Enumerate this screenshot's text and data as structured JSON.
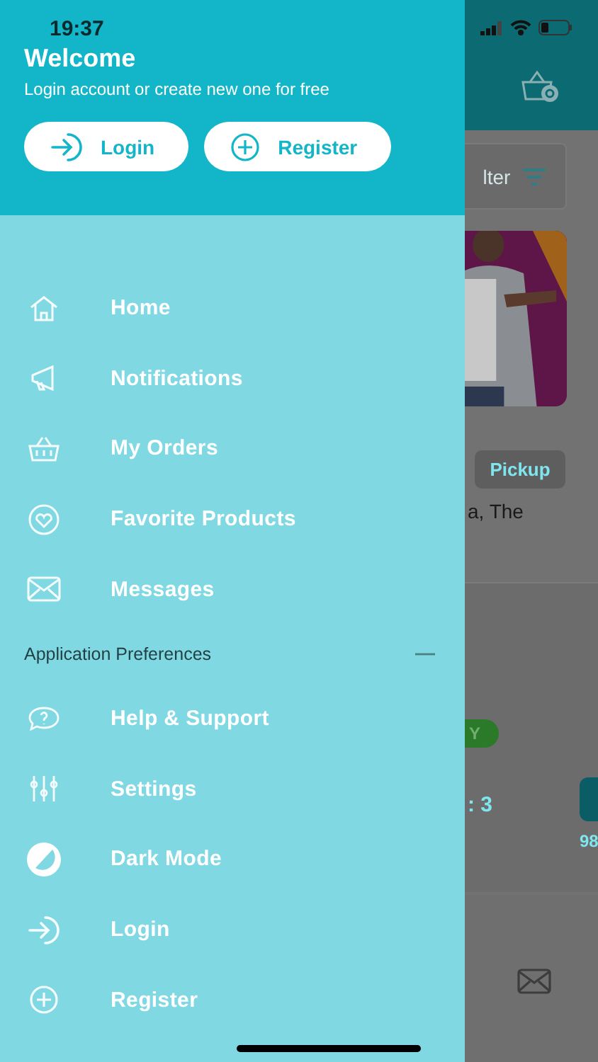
{
  "status_bar": {
    "time": "19:37"
  },
  "drawer": {
    "title": "Welcome",
    "subtitle": "Login account or create new one for free",
    "buttons": [
      {
        "label": "Login"
      },
      {
        "label": "Register"
      }
    ],
    "menu": [
      {
        "label": "Home"
      },
      {
        "label": "Notifications"
      },
      {
        "label": "My Orders"
      },
      {
        "label": "Favorite Products"
      },
      {
        "label": "Messages"
      }
    ],
    "section": {
      "title": "Application Preferences",
      "expanded": true
    },
    "preferences": [
      {
        "label": "Help & Support"
      },
      {
        "label": "Settings"
      },
      {
        "label": "Dark Mode"
      },
      {
        "label": "Login"
      },
      {
        "label": "Register"
      }
    ]
  },
  "background": {
    "filter": "lter",
    "tag": "Pickup",
    "text": "a, The",
    "badge": "Y",
    "count": ": 3",
    "price": "98"
  }
}
